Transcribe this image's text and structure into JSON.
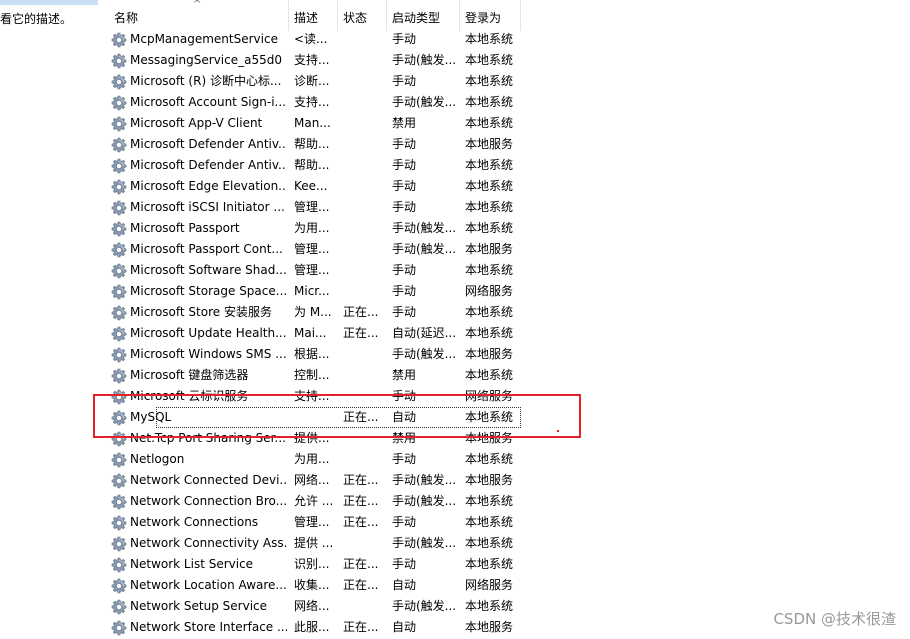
{
  "left_panel": {
    "description_fragment": "看它的描述。"
  },
  "columns": {
    "name": "名称",
    "description": "描述",
    "status": "状态",
    "startup_type": "启动类型",
    "logon_as": "登录为"
  },
  "services": [
    {
      "name": "McpManagementService",
      "desc": "<读...",
      "status": "",
      "startup": "手动",
      "logon": "本地系统"
    },
    {
      "name": "MessagingService_a55d0",
      "desc": "支持...",
      "status": "",
      "startup": "手动(触发...",
      "logon": "本地系统"
    },
    {
      "name": "Microsoft (R) 诊断中心标...",
      "desc": "诊断...",
      "status": "",
      "startup": "手动",
      "logon": "本地系统"
    },
    {
      "name": "Microsoft Account Sign-i...",
      "desc": "支持...",
      "status": "",
      "startup": "手动(触发...",
      "logon": "本地系统"
    },
    {
      "name": "Microsoft App-V Client",
      "desc": "Man...",
      "status": "",
      "startup": "禁用",
      "logon": "本地系统"
    },
    {
      "name": "Microsoft Defender Antiv...",
      "desc": "帮助...",
      "status": "",
      "startup": "手动",
      "logon": "本地服务"
    },
    {
      "name": "Microsoft Defender Antiv...",
      "desc": "帮助...",
      "status": "",
      "startup": "手动",
      "logon": "本地系统"
    },
    {
      "name": "Microsoft Edge Elevation...",
      "desc": "Kee...",
      "status": "",
      "startup": "手动",
      "logon": "本地系统"
    },
    {
      "name": "Microsoft iSCSI Initiator ...",
      "desc": "管理...",
      "status": "",
      "startup": "手动",
      "logon": "本地系统"
    },
    {
      "name": "Microsoft Passport",
      "desc": "为用...",
      "status": "",
      "startup": "手动(触发...",
      "logon": "本地系统"
    },
    {
      "name": "Microsoft Passport Cont...",
      "desc": "管理...",
      "status": "",
      "startup": "手动(触发...",
      "logon": "本地服务"
    },
    {
      "name": "Microsoft Software Shad...",
      "desc": "管理...",
      "status": "",
      "startup": "手动",
      "logon": "本地系统"
    },
    {
      "name": "Microsoft Storage Space...",
      "desc": "Micr...",
      "status": "",
      "startup": "手动",
      "logon": "网络服务"
    },
    {
      "name": "Microsoft Store 安装服务",
      "desc": "为 M...",
      "status": "正在...",
      "startup": "手动",
      "logon": "本地系统"
    },
    {
      "name": "Microsoft Update Health...",
      "desc": "Mai...",
      "status": "正在...",
      "startup": "自动(延迟...",
      "logon": "本地系统"
    },
    {
      "name": "Microsoft Windows SMS ...",
      "desc": "根据...",
      "status": "",
      "startup": "手动(触发...",
      "logon": "本地服务"
    },
    {
      "name": "Microsoft 键盘筛选器",
      "desc": "控制...",
      "status": "",
      "startup": "禁用",
      "logon": "本地系统"
    },
    {
      "name": "Microsoft 云标识服务",
      "desc": "支持...",
      "status": "",
      "startup": "手动",
      "logon": "网络服务"
    },
    {
      "name": "MySQL",
      "desc": "",
      "status": "正在...",
      "startup": "自动",
      "logon": "本地系统"
    },
    {
      "name": "Net.Tcp Port Sharing Ser...",
      "desc": "提供...",
      "status": "",
      "startup": "禁用",
      "logon": "本地服务"
    },
    {
      "name": "Netlogon",
      "desc": "为用...",
      "status": "",
      "startup": "手动",
      "logon": "本地系统"
    },
    {
      "name": "Network Connected Devi...",
      "desc": "网络...",
      "status": "正在...",
      "startup": "手动(触发...",
      "logon": "本地服务"
    },
    {
      "name": "Network Connection Bro...",
      "desc": "允许 ...",
      "status": "正在...",
      "startup": "手动(触发...",
      "logon": "本地系统"
    },
    {
      "name": "Network Connections",
      "desc": "管理...",
      "status": "正在...",
      "startup": "手动",
      "logon": "本地系统"
    },
    {
      "name": "Network Connectivity Ass...",
      "desc": "提供 ...",
      "status": "",
      "startup": "手动(触发...",
      "logon": "本地系统"
    },
    {
      "name": "Network List Service",
      "desc": "识别...",
      "status": "正在...",
      "startup": "手动",
      "logon": "本地系统"
    },
    {
      "name": "Network Location Aware...",
      "desc": "收集...",
      "status": "正在...",
      "startup": "自动",
      "logon": "网络服务"
    },
    {
      "name": "Network Setup Service",
      "desc": "网络...",
      "status": "",
      "startup": "手动(触发...",
      "logon": "本地系统"
    },
    {
      "name": "Network Store Interface ...",
      "desc": "此服...",
      "status": "正在...",
      "startup": "自动",
      "logon": "本地服务"
    }
  ],
  "selected_service": "MySQL",
  "highlight_color": "#e5222a",
  "icon": "gear-service-icon",
  "watermark": "CSDN @技术很渣"
}
